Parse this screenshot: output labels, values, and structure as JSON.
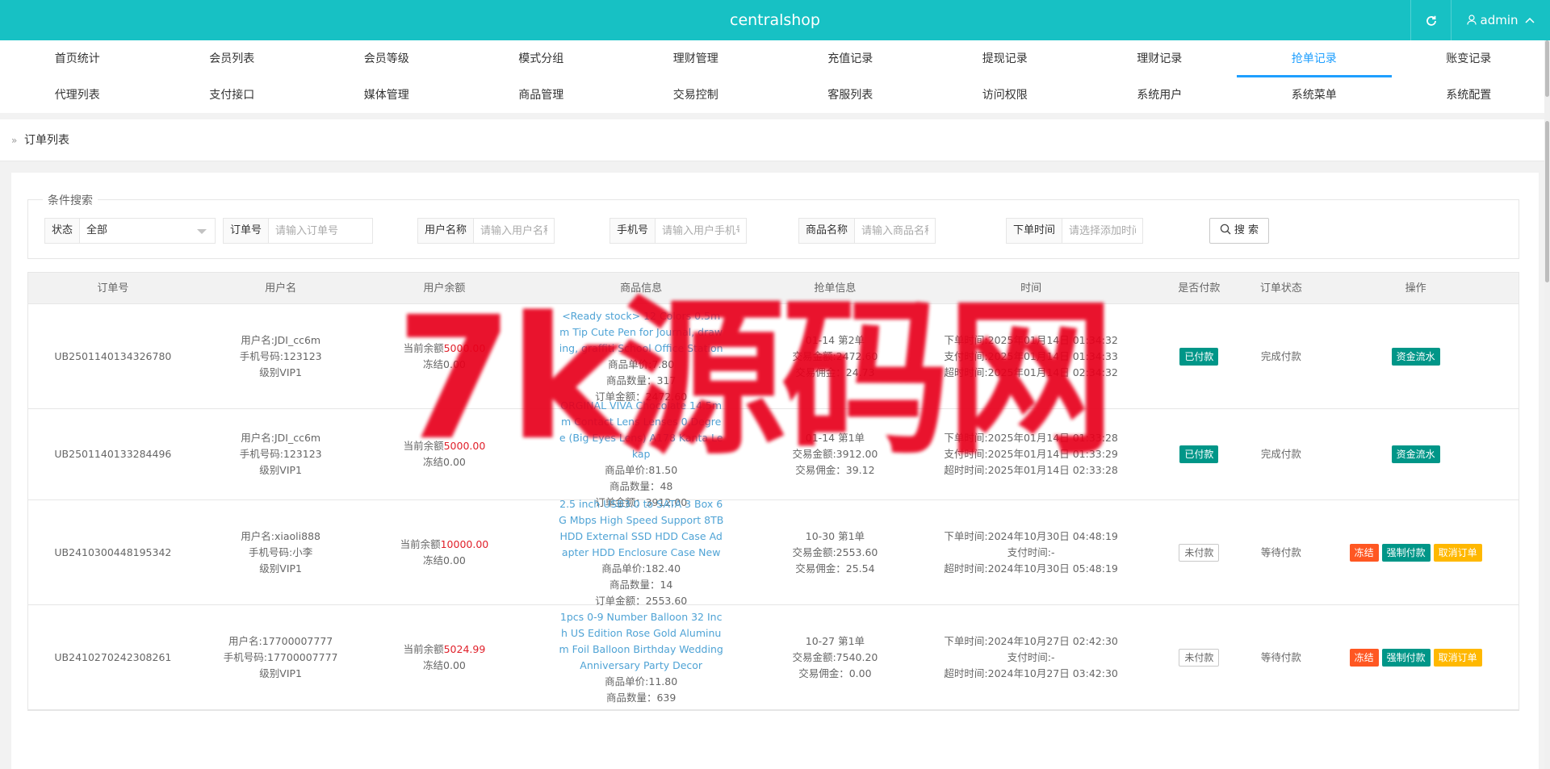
{
  "app": {
    "title": "centralshop",
    "user": "admin"
  },
  "nav": {
    "items": [
      "首页统计",
      "会员列表",
      "会员等级",
      "模式分组",
      "理财管理",
      "充值记录",
      "提现记录",
      "理财记录",
      "抢单记录",
      "账变记录",
      "代理列表",
      "支付接口",
      "媒体管理",
      "商品管理",
      "交易控制",
      "客服列表",
      "访问权限",
      "系统用户",
      "系统菜单",
      "系统配置"
    ],
    "active": "抢单记录"
  },
  "breadcrumb": "订单列表",
  "filters": {
    "legend": "条件搜索",
    "status_label": "状态",
    "status_value": "全部",
    "order_label": "订单号",
    "order_placeholder": "请输入订单号",
    "username_label": "用户名称",
    "username_placeholder": "请输入用户名称",
    "phone_label": "手机号",
    "phone_placeholder": "请输入用户手机号",
    "goods_label": "商品名称",
    "goods_placeholder": "请输入商品名称",
    "time_label": "下单时间",
    "time_placeholder": "请选择添加时间",
    "search_label": "搜 索"
  },
  "table": {
    "headers": [
      "订单号",
      "用户名",
      "用户余额",
      "商品信息",
      "抢单信息",
      "时间",
      "是否付款",
      "订单状态",
      "操作"
    ],
    "rows": [
      {
        "order_no": "UB2501140134326780",
        "user": [
          "用户名:JDI_cc6m",
          "手机号码:123123",
          "级别VIP1"
        ],
        "balance_prefix": "当前余额",
        "balance": "5000.00",
        "frozen": "冻结0.00",
        "goods_name": "<Ready stock> 12 Colors 0.5mm Tip Cute Pen for Journal, drawing, graffiti School Office Station",
        "goods_details": [
          "商品单价:7.80",
          "商品数量：317",
          "订单金额：2472.60"
        ],
        "grab": [
          "01-14 第2单",
          "交易金额:2472.60",
          "交易佣金：24.73"
        ],
        "times": [
          "下单时间:2025年01月14日 01:34:32",
          "支付时间:2025年01月14日 01:34:33",
          "超时时间:2025年01月14日 02:34:32"
        ],
        "paid": "已付款",
        "paid_state": "paid",
        "status": "完成付款",
        "actions": [
          {
            "label": "资金流水",
            "color": "teal"
          }
        ]
      },
      {
        "order_no": "UB2501140133284496",
        "user": [
          "用户名:JDI_cc6m",
          "手机号码:123123",
          "级别VIP1"
        ],
        "balance_prefix": "当前余额",
        "balance": "5000.00",
        "frozen": "冻结0.00",
        "goods_name": "ORGINAL VIVA Chocolate 14.5mm Contact Lens Lenses 0,Degree (Big Eyes Lens) A178 Kanta Lekap",
        "goods_details": [
          "商品单价:81.50",
          "商品数量：48",
          "订单金额：3912.00"
        ],
        "grab": [
          "01-14 第1单",
          "交易金额:3912.00",
          "交易佣金：39.12"
        ],
        "times": [
          "下单时间:2025年01月14日 01:33:28",
          "支付时间:2025年01月14日 01:33:29",
          "超时时间:2025年01月14日 02:33:28"
        ],
        "paid": "已付款",
        "paid_state": "paid",
        "status": "完成付款",
        "actions": [
          {
            "label": "资金流水",
            "color": "teal"
          }
        ]
      },
      {
        "order_no": "UB2410300448195342",
        "user": [
          "用户名:xiaoli888",
          "手机号码:小李",
          "级别VIP1"
        ],
        "balance_prefix": "当前余额",
        "balance": "10000.00",
        "frozen": "冻结0.00",
        "goods_name": "2.5 inch USB3.0 to SATA 3 Box 6G Mbps High Speed Support 8TB HDD External SSD HDD Case Adapter HDD Enclosure Case New",
        "goods_details": [
          "商品单价:182.40",
          "商品数量：14",
          "订单金额：2553.60"
        ],
        "grab": [
          "10-30 第1单",
          "交易金额:2553.60",
          "交易佣金：25.54"
        ],
        "times": [
          "下单时间:2024年10月30日 04:48:19",
          "支付时间:-",
          "超时时间:2024年10月30日 05:48:19"
        ],
        "paid": "未付款",
        "paid_state": "unpaid",
        "status": "等待付款",
        "actions": [
          {
            "label": "冻结",
            "color": "orange"
          },
          {
            "label": "强制付款",
            "color": "teal"
          },
          {
            "label": "取消订单",
            "color": "yellow"
          }
        ]
      },
      {
        "order_no": "UB2410270242308261",
        "user": [
          "用户名:17700007777",
          "手机号码:17700007777",
          "级别VIP1"
        ],
        "balance_prefix": "当前余额",
        "balance": "5024.99",
        "frozen": "冻结0.00",
        "goods_name": "1pcs 0-9 Number Balloon 32 Inch US Edition Rose Gold Aluminum Foil Balloon Birthday Wedding Anniversary Party Decor",
        "goods_details": [
          "商品单价:11.80",
          "商品数量：639"
        ],
        "grab": [
          "10-27 第1单",
          "交易金额:7540.20",
          "交易佣金：0.00"
        ],
        "times": [
          "下单时间:2024年10月27日 02:42:30",
          "支付时间:-",
          "超时时间:2024年10月27日 03:42:30"
        ],
        "paid": "未付款",
        "paid_state": "unpaid",
        "status": "等待付款",
        "actions": [
          {
            "label": "冻结",
            "color": "orange"
          },
          {
            "label": "强制付款",
            "color": "teal"
          },
          {
            "label": "取消订单",
            "color": "yellow"
          }
        ]
      }
    ]
  },
  "watermark": "7k源码网",
  "icons": {
    "refresh": "refresh-icon",
    "user": "user-icon",
    "caret": "chevron-up-icon",
    "search": "search-icon"
  }
}
